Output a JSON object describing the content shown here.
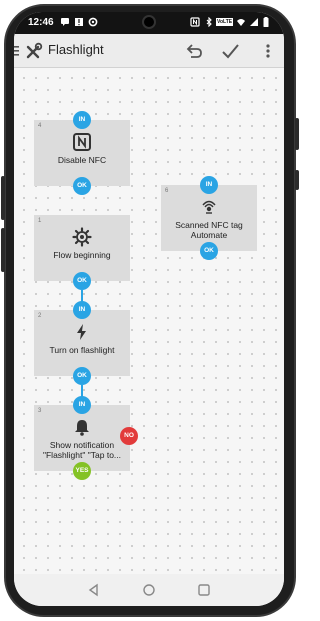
{
  "status_bar": {
    "time": "12:46",
    "left_icons": [
      "chat-icon",
      "info-icon",
      "settings-icon"
    ],
    "right_icons": [
      "nfc-icon",
      "bluetooth-icon",
      "volte-icon",
      "wifi-icon",
      "signal-icon",
      "battery-icon"
    ],
    "volte_label": "VoLTE"
  },
  "app_bar": {
    "title": "Flashlight",
    "actions": [
      "menu-icon",
      "tools-icon",
      "undo-icon",
      "check-icon",
      "more-icon"
    ]
  },
  "flow": {
    "blocks": [
      {
        "id": "4",
        "label": "Disable NFC",
        "icon": "nfc-icon",
        "pins": {
          "in": "IN",
          "out": "OK"
        }
      },
      {
        "id": "1",
        "label": "Flow beginning",
        "icon": "gear-icon",
        "pins": {
          "out": "OK"
        }
      },
      {
        "id": "2",
        "label": "Turn on flashlight",
        "icon": "flash-icon",
        "pins": {
          "in": "IN",
          "out": "OK"
        }
      },
      {
        "id": "3",
        "label": "Show notification \"Flashlight\" \"Tap to...",
        "icon": "bell-icon",
        "pins": {
          "in": "IN",
          "no": "NO",
          "yes": "YES"
        }
      },
      {
        "id": "6",
        "label": "Scanned NFC tag Automate",
        "icon": "nfc-scan-icon",
        "pins": {
          "in": "IN",
          "out": "OK"
        }
      }
    ]
  },
  "nav_bar": {
    "buttons": [
      "back-icon",
      "home-icon",
      "recents-icon"
    ]
  },
  "colors": {
    "pin_blue": "#2aa4e4",
    "pin_red": "#e23b3b",
    "pin_green": "#84c225",
    "block_bg": "#dcdcdc"
  }
}
